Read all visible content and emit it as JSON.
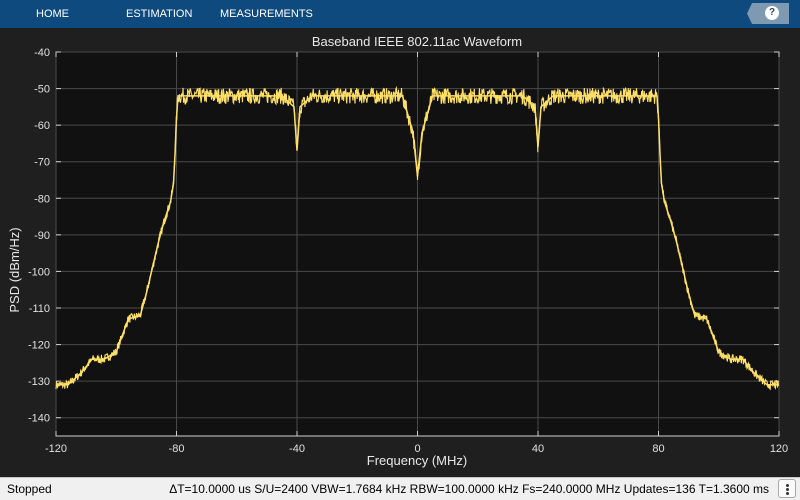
{
  "toolstrip": {
    "tabs": [
      "HOME",
      "ESTIMATION",
      "MEASUREMENTS"
    ],
    "help_label": "?"
  },
  "colors": {
    "trace": "#ffe066",
    "plot_background": "#111111",
    "figure_background": "#1f1f1f",
    "toolstrip": "#0e4a7d"
  },
  "chart_data": {
    "type": "line",
    "title": "Baseband IEEE 802.11ac Waveform",
    "xlabel": "Frequency (MHz)",
    "ylabel": "PSD (dBm/Hz)",
    "xlim": [
      -120,
      120
    ],
    "ylim": [
      -145,
      -40
    ],
    "xticks": [
      -120,
      -80,
      -40,
      0,
      40,
      80,
      120
    ],
    "yticks": [
      -40,
      -50,
      -60,
      -70,
      -80,
      -90,
      -100,
      -110,
      -120,
      -130,
      -140
    ],
    "grid": true,
    "series": [
      {
        "x": [
          -120,
          -116,
          -112,
          -108,
          -104,
          -100,
          -96,
          -92,
          -90,
          -88,
          -86,
          -84,
          -82,
          -81,
          -80.5,
          -80,
          -79.5,
          -79,
          -60,
          -45,
          -41,
          -40,
          -39,
          -35,
          -20,
          -5,
          -1.5,
          0,
          1.5,
          5,
          20,
          35,
          39,
          40,
          41,
          45,
          60,
          79,
          79.5,
          80,
          80.5,
          81,
          82,
          84,
          86,
          88,
          90,
          92,
          96,
          100,
          104,
          108,
          112,
          116,
          120
        ],
        "y": [
          -131,
          -131,
          -128,
          -124,
          -124,
          -122,
          -113,
          -112,
          -106,
          -99,
          -92,
          -86,
          -81,
          -76,
          -68,
          -58,
          -52,
          -52,
          -52,
          -52,
          -55,
          -67,
          -55,
          -52,
          -52,
          -52,
          -62,
          -74,
          -62,
          -52,
          -52,
          -52,
          -55,
          -66,
          -55,
          -52,
          -52,
          -52,
          -52,
          -58,
          -68,
          -76,
          -81,
          -86,
          -92,
          -99,
          -106,
          -112,
          -113,
          -122,
          -124,
          -124,
          -128,
          -131,
          -131
        ]
      }
    ]
  },
  "status": {
    "state": "Stopped",
    "metrics": "ΔT=10.0000 us  S/U=2400  VBW=1.7684 kHz  RBW=100.0000 kHz  Fs=240.0000 MHz  Updates=136  T=1.3600 ms"
  }
}
